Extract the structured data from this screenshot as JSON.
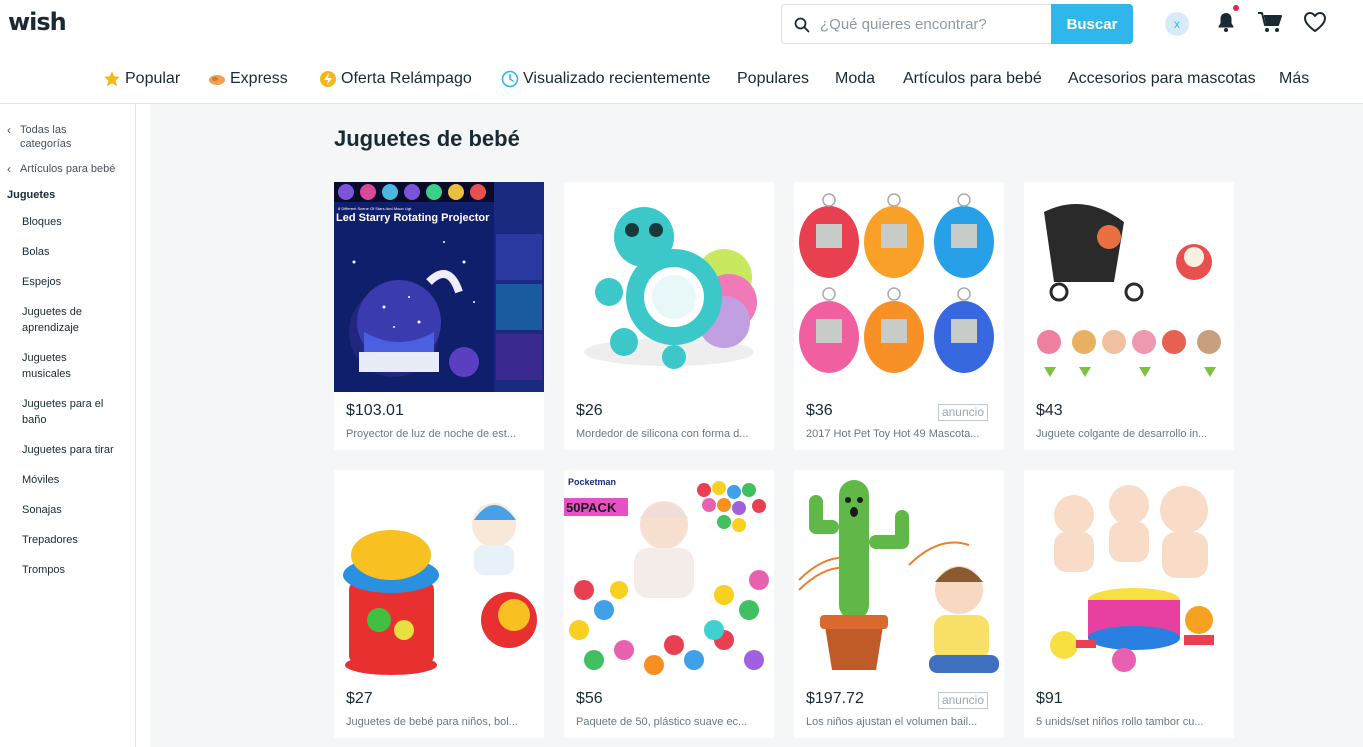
{
  "header": {
    "logo": "wish",
    "search_placeholder": "¿Qué quieres encontrar?",
    "search_button": "Buscar",
    "avatar_initial": "x"
  },
  "nav": {
    "items": [
      {
        "label": "Popular",
        "icon": "star-icon"
      },
      {
        "label": "Express",
        "icon": "express-icon"
      },
      {
        "label": "Oferta Relámpago",
        "icon": "flash-deal-icon"
      },
      {
        "label": "Visualizado recientemente",
        "icon": "clock-icon"
      },
      {
        "label": "Populares"
      },
      {
        "label": "Moda"
      },
      {
        "label": "Artículos para bebé"
      },
      {
        "label": "Accesorios para mascotas"
      },
      {
        "label": "Más"
      }
    ]
  },
  "sidebar": {
    "back_all": "Todas las categorías",
    "back_parent": "Artículos para bebé",
    "current": "Juguetes",
    "items": [
      "Bloques",
      "Bolas",
      "Espejos",
      "Juguetes de aprendizaje",
      "Juguetes musicales",
      "Juguetes para el baño",
      "Juguetes para tirar",
      "Móviles",
      "Sonajas",
      "Trepadores",
      "Trompos"
    ]
  },
  "main": {
    "title": "Juguetes de bebé",
    "ad_label": "anuncio",
    "products": [
      {
        "price": "$103.01",
        "desc": "Proyector de luz de noche de est...",
        "ad": false,
        "image_text": "Led Starry Rotating Projector",
        "image_subtext": "8 Different Scene Of Stars And Moon Ligt"
      },
      {
        "price": "$26",
        "desc": "Mordedor de silicona con forma d...",
        "ad": false
      },
      {
        "price": "$36",
        "desc": "2017 Hot Pet Toy Hot 49 Mascota...",
        "ad": true
      },
      {
        "price": "$43",
        "desc": "Juguete colgante de desarrollo in...",
        "ad": false
      },
      {
        "price": "$27",
        "desc": "Juguetes de bebé para niños, bol...",
        "ad": false
      },
      {
        "price": "$56",
        "desc": "Paquete de 50, plástico suave ec...",
        "ad": false,
        "image_text": "50PACK",
        "image_brand": "Pocketman"
      },
      {
        "price": "$197.72",
        "desc": "Los niños ajustan el volumen bail...",
        "ad": true
      },
      {
        "price": "$91",
        "desc": "5 unids/set niños rollo tambor cu...",
        "ad": false
      }
    ]
  }
}
